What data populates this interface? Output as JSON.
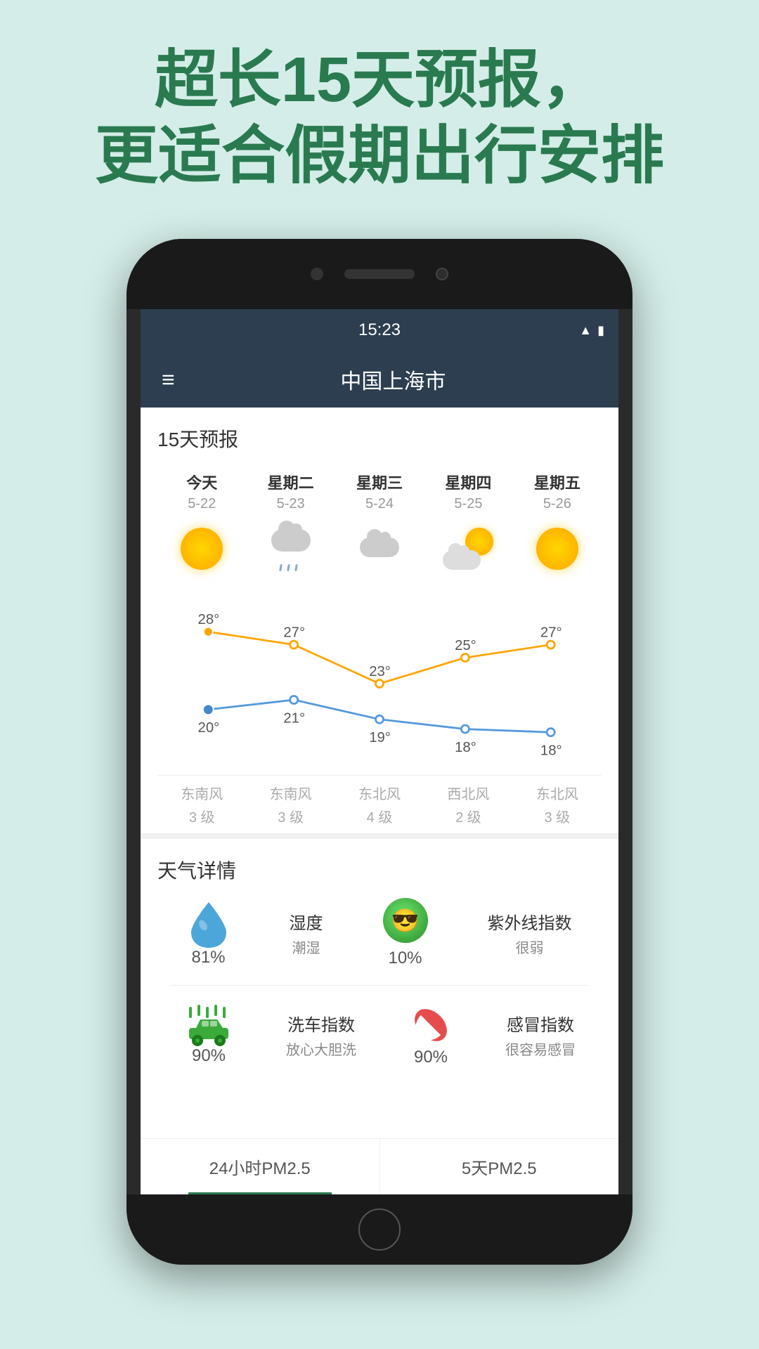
{
  "page": {
    "bg_color": "#d4ede8",
    "headline_line1": "超长15天预报，",
    "headline_line2": "更适合假期出行安排"
  },
  "status_bar": {
    "time": "15:23"
  },
  "navbar": {
    "city": "中国上海市"
  },
  "forecast": {
    "section_title": "15天预报",
    "days": [
      {
        "name": "今天",
        "date": "5-22",
        "weather": "sunny",
        "high": "28°",
        "low": "20°",
        "wind_dir": "东南风",
        "wind_level": "3 级"
      },
      {
        "name": "星期二",
        "date": "5-23",
        "weather": "cloudy-rain",
        "high": "27°",
        "low": "21°",
        "wind_dir": "东南风",
        "wind_level": "3 级"
      },
      {
        "name": "星期三",
        "date": "5-24",
        "weather": "cloudy",
        "high": "23°",
        "low": "19°",
        "wind_dir": "东北风",
        "wind_level": "4 级"
      },
      {
        "name": "星期四",
        "date": "5-25",
        "weather": "partly-cloudy",
        "high": "25°",
        "low": "18°",
        "wind_dir": "西北风",
        "wind_level": "2 级"
      },
      {
        "name": "星期五",
        "date": "5-26",
        "weather": "sunny",
        "high": "27°",
        "low": "18°",
        "wind_dir": "东北风",
        "wind_level": "3 级"
      }
    ]
  },
  "details": {
    "section_title": "天气详情",
    "humidity": {
      "icon": "water",
      "value": "81%",
      "label": "湿度",
      "desc": "潮湿"
    },
    "uv": {
      "icon": "emoji-sunglasses",
      "value": "10%",
      "label": "紫外线指数",
      "desc": "很弱"
    },
    "car_wash": {
      "icon": "car",
      "value": "90%",
      "label": "洗车指数",
      "desc": "放心大胆洗"
    },
    "cold": {
      "icon": "pill",
      "value": "90%",
      "label": "感冒指数",
      "desc": "很容易感冒"
    }
  },
  "bottom_tabs": {
    "tab1": "24小时PM2.5",
    "tab2": "5天PM2.5"
  }
}
